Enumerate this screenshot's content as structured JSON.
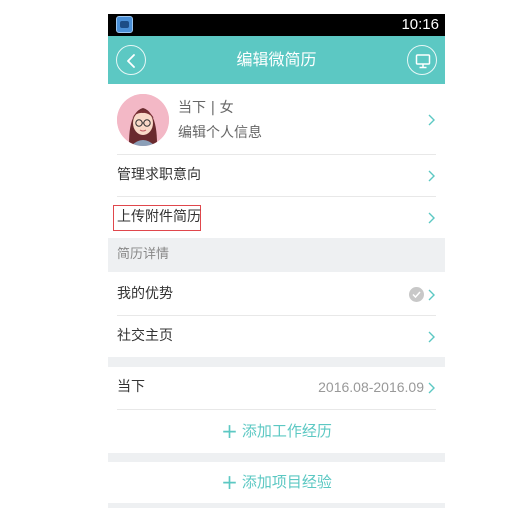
{
  "status_bar": {
    "time": "10:16",
    "app_icon": "app-icon"
  },
  "nav": {
    "title": "编辑微简历",
    "back_icon": "chevron-left-icon",
    "right_icon": "monitor-icon"
  },
  "profile": {
    "status_gender": "当下 | 女",
    "edit_label": "编辑个人信息"
  },
  "menu": {
    "job_intent": "管理求职意向",
    "upload_attachment": "上传附件简历"
  },
  "resume_details": {
    "header": "简历详情",
    "advantage": "我的优势",
    "social_home": "社交主页"
  },
  "work": {
    "company": "当下",
    "date_range": "2016.08-2016.09",
    "add_work": "添加工作经历"
  },
  "project": {
    "add_project": "添加项目经验"
  },
  "colors": {
    "accent": "#5cc8c3",
    "highlight_border": "#e0474c",
    "band": "#eef0f2"
  }
}
